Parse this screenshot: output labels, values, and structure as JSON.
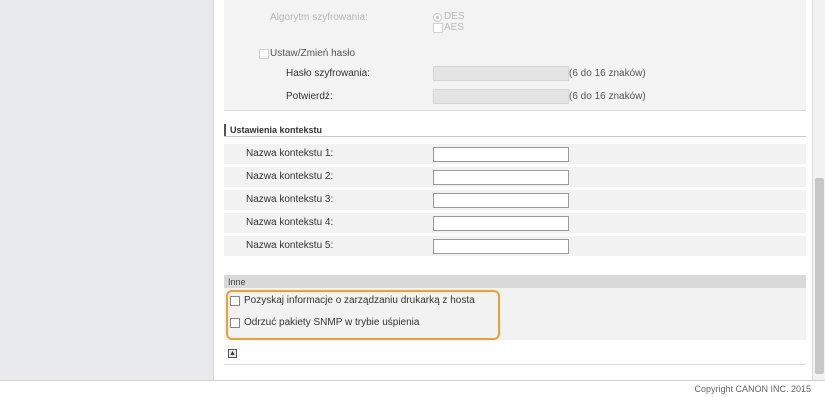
{
  "encryption": {
    "algorithm_label": "Algorytm szyfrowania:",
    "options": [
      "DES",
      "AES"
    ],
    "selected": "DES",
    "set_password_label": "Ustaw/Zmień hasło",
    "password_label": "Hasło szyfrowania:",
    "confirm_label": "Potwierdź:",
    "password_hint": "(6 do 16 znaków)",
    "confirm_hint": "(6 do 16 znaków)"
  },
  "context": {
    "title": "Ustawienia kontekstu",
    "fields": [
      {
        "label": "Nazwa kontekstu 1:",
        "value": ""
      },
      {
        "label": "Nazwa kontekstu 2:",
        "value": ""
      },
      {
        "label": "Nazwa kontekstu 3:",
        "value": ""
      },
      {
        "label": "Nazwa kontekstu 4:",
        "value": ""
      },
      {
        "label": "Nazwa kontekstu 5:",
        "value": ""
      }
    ]
  },
  "other": {
    "title": "Inne",
    "options": [
      {
        "label": "Pozyskaj informacje o zarządzaniu drukarką z hosta",
        "checked": false
      },
      {
        "label": "Odrzuć pakiety SNMP w trybie uśpienia",
        "checked": false
      }
    ],
    "top_icon": "back-to-top-icon",
    "highlight_color": "#f0a030"
  },
  "footer": {
    "copyright": "Copyright CANON INC. 2015"
  }
}
